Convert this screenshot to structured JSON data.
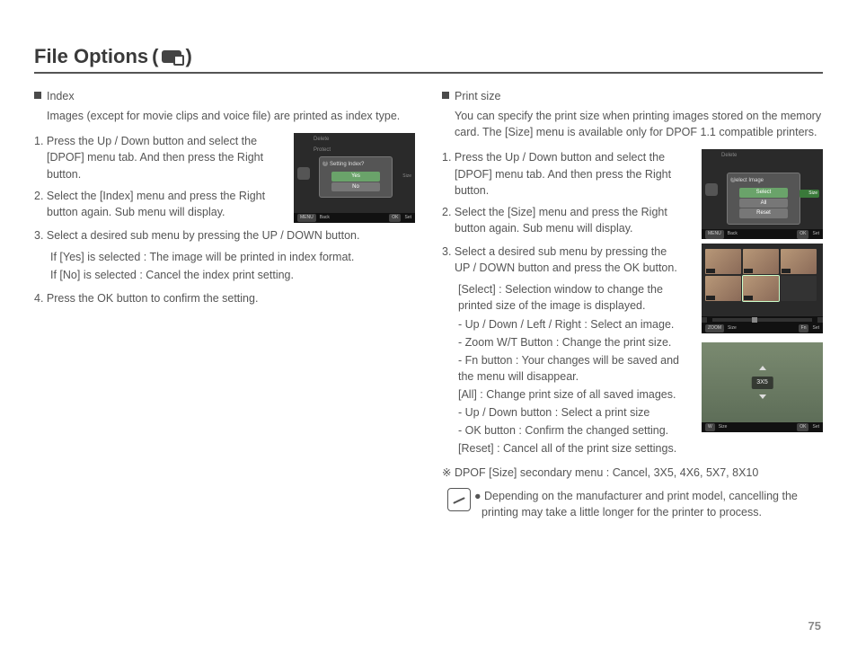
{
  "page_number": "75",
  "title": "File Options",
  "paren": {
    "open": "(",
    "close": ")"
  },
  "left": {
    "heading": "Index",
    "intro": "Images (except for movie clips and voice file) are printed as index type.",
    "s1": "1. Press the Up / Down button and select the [DPOF] menu tab. And then press the Right button.",
    "s2": "2. Select the [Index] menu and press the Right button again. Sub menu will display.",
    "s3": "3. Select a desired sub menu by pressing the UP / DOWN button.",
    "s3a": "If [Yes] is selected : The image will be printed in index format.",
    "s3b": "If [No] is selected  : Cancel the index print setting.",
    "s4": "4. Press the OK button to confirm the setting.",
    "cam": {
      "m1": "Delete",
      "m2": "Protect",
      "popup_title": "Setting Index?",
      "yes": "Yes",
      "no": "No",
      "r_size": "Size",
      "back_btn": "MENU",
      "back": "Back",
      "set_btn": "OK",
      "set": "Set"
    }
  },
  "right": {
    "heading": "Print size",
    "intro": "You can specify the print size when printing images stored on the memory card. The [Size] menu is available only for DPOF 1.1 compatible printers.",
    "s1": "1. Press the Up / Down button and select the [DPOF] menu tab. And then press the Right button.",
    "s2": "2. Select the [Size] menu and press the Right button again. Sub menu will display.",
    "s3": "3. Select a desired sub menu by pressing the UP / DOWN button and press the OK button.",
    "sel": "[Select] : Selection window to change the printed size of the image is displayed.",
    "b1": "- Up / Down / Left / Right : Select an image.",
    "b2": "- Zoom W/T Button : Change the print size.",
    "b3": "- Fn button : Your changes will be saved and the menu will disappear.",
    "all": "[All] : Change print size of all saved images.",
    "b4": "- Up / Down button : Select a print size",
    "b5": "- OK button : Confirm the changed setting.",
    "reset": "[Reset] : Cancel all of the print size settings.",
    "secondary": "※ DPOF [Size] secondary menu : Cancel, 3X5, 4X6, 5X7, 8X10",
    "note": "● Depending on the manufacturer and print model, cancelling the printing may take a little longer for the printer to process.",
    "cam1": {
      "m1": "Delete",
      "popup_title": "Select Image",
      "o1": "Select",
      "o2": "All",
      "o3": "Reset",
      "r_size": "Size",
      "back_btn": "MENU",
      "back": "Back",
      "set_btn": "OK",
      "set": "Set"
    },
    "cam2": {
      "size_btn": "ZOOM",
      "size": "Size",
      "set_btn": "Fn",
      "set": "Set"
    },
    "cam3": {
      "label": "3X5",
      "size_btn": "W",
      "size": "Size",
      "set_btn": "OK",
      "set": "Set"
    }
  }
}
